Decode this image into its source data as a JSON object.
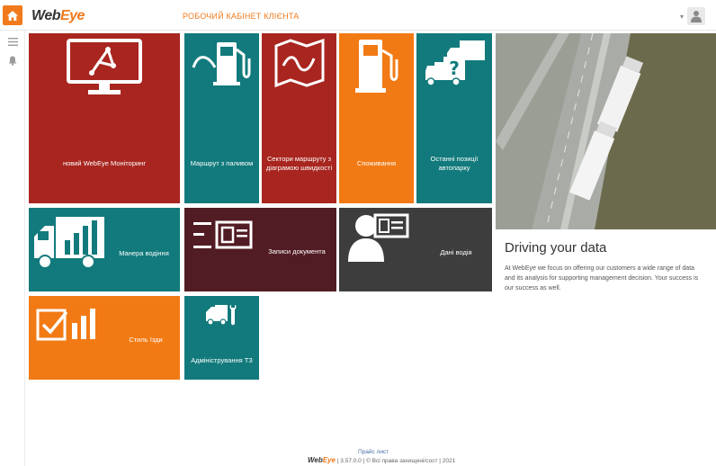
{
  "header": {
    "brand_web": "Web",
    "brand_eye": "Eye",
    "cabinet_title": "РОБОЧИЙ КАБІНЕТ КЛІЄНТА"
  },
  "tiles": [
    {
      "id": "monitoring",
      "label": "новий WebEye Моніторинг",
      "color": "#a8261f",
      "icon": "monitor-route-icon"
    },
    {
      "id": "fuel-routes",
      "label": "Маршрут з паливом",
      "color": "#127a7c",
      "icon": "fuel-route-icon"
    },
    {
      "id": "speed-sectors",
      "label": "Сектори маршруту з діаграмою швидкості",
      "color": "#a8261f",
      "icon": "map-icon"
    },
    {
      "id": "consumption",
      "label": "Споживання",
      "color": "#f27a14",
      "icon": "fuel-pump-icon"
    },
    {
      "id": "last-positions",
      "label": "Останні позиції автопарку",
      "color": "#127a7c",
      "icon": "trucks-question-icon"
    },
    {
      "id": "driving-style",
      "label": "Манера водіння",
      "color": "#127a7c",
      "icon": "truck-chart-icon"
    },
    {
      "id": "documents",
      "label": "Записи документа",
      "color": "#521c24",
      "icon": "document-list-icon"
    },
    {
      "id": "driver-data",
      "label": "Дані водія",
      "color": "#3d3d3d",
      "icon": "driver-card-icon"
    },
    {
      "id": "fuel-level",
      "label": "Стиль їзди",
      "color": "#f27a14",
      "icon": "checkbox-chart-icon"
    },
    {
      "id": "vehicle-admin",
      "label": "Адміністрування ТЗ",
      "color": "#127a7c",
      "icon": "truck-wrench-icon"
    }
  ],
  "panel": {
    "title": "Driving your data",
    "text": "At WebEye we focus on offering our customers a wide range of data and its analysis for supporting management decision. Your success is our success as well."
  },
  "footer": {
    "link": "Прайс лист",
    "brand_web": "Web",
    "brand_eye": "Eye",
    "copyright": "| 3.57.0.0 | © Всі права захищені/сост | 2021"
  }
}
